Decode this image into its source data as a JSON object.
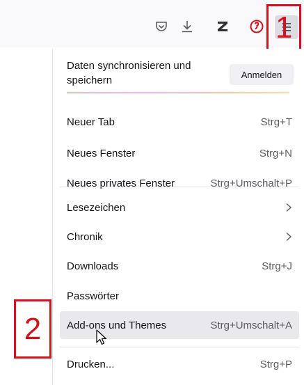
{
  "toolbar": {
    "icons": [
      "pocket-icon",
      "download-icon",
      "zotero-icon",
      "extension-icon",
      "app-menu-icon"
    ]
  },
  "callouts": {
    "one": "1",
    "two": "2"
  },
  "menu": {
    "sync_text": "Daten synchronisieren und speichern",
    "sync_button": "Anmelden",
    "items": [
      {
        "label": "Neuer Tab",
        "shortcut": "Strg+T"
      },
      {
        "label": "Neues Fenster",
        "shortcut": "Strg+N"
      },
      {
        "label": "Neues privates Fenster",
        "shortcut": "Strg+Umschalt+P"
      },
      {
        "label": "Lesezeichen",
        "shortcut": ""
      },
      {
        "label": "Chronik",
        "shortcut": ""
      },
      {
        "label": "Downloads",
        "shortcut": "Strg+J"
      },
      {
        "label": "Passwörter",
        "shortcut": ""
      },
      {
        "label": "Add-ons und Themes",
        "shortcut": "Strg+Umschalt+A"
      },
      {
        "label": "Drucken...",
        "shortcut": "Strg+P"
      }
    ]
  },
  "colors": {
    "callout": "#d4121c",
    "hover": "#e8e8ed"
  }
}
